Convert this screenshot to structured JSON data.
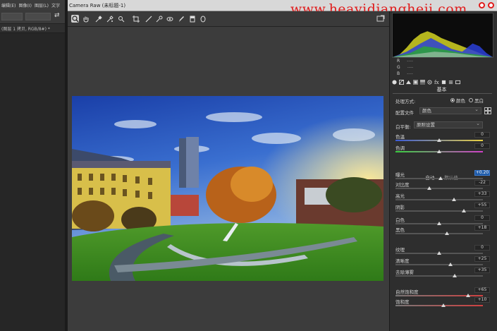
{
  "ps": {
    "menu": [
      "编辑(E)",
      "图像(I)",
      "图层(L)",
      "文字"
    ],
    "doc_tab": "(图层 1 拷贝, RGB/8#) *"
  },
  "camera_raw": {
    "title": "Camera Raw (未标题-1)",
    "watermark": "www.heavidiangheji.com",
    "toolbar_icons": [
      "zoom-icon",
      "hand-icon",
      "white-balance-icon",
      "color-sampler-icon",
      "targeted-adjust-icon",
      "crop-icon",
      "straighten-icon",
      "spot-removal-icon",
      "red-eye-icon",
      "adjustment-brush-icon",
      "graduated-filter-icon",
      "radial-filter-icon"
    ],
    "readout": [
      {
        "label": "R",
        "value": "----"
      },
      {
        "label": "G",
        "value": "----"
      },
      {
        "label": "B",
        "value": "----"
      }
    ],
    "panel": {
      "section_title": "基本",
      "treatment_label": "处理方式:",
      "treatment_options": [
        "颜色",
        "黑白"
      ],
      "treatment_selected": "颜色",
      "profile_label": "配置文件",
      "profile_value": "颜色",
      "wb_label": "白平衡:",
      "wb_value": "原照设置",
      "auto_label": "自动",
      "default_label": "默认值",
      "sliders": [
        {
          "label": "色温",
          "value": "0",
          "level": 0.5,
          "highlight": false
        },
        {
          "label": "色调",
          "value": "0",
          "level": 0.5,
          "highlight": false
        },
        {
          "label": "曝光",
          "value": "+0.20",
          "level": 0.52,
          "highlight": true
        },
        {
          "label": "对比度",
          "value": "-22",
          "level": 0.39,
          "highlight": false
        },
        {
          "label": "高光",
          "value": "+33",
          "level": 0.67,
          "highlight": false
        },
        {
          "label": "阴影",
          "value": "+55",
          "level": 0.78,
          "highlight": false
        },
        {
          "label": "白色",
          "value": "0",
          "level": 0.5,
          "highlight": false
        },
        {
          "label": "黑色",
          "value": "+18",
          "level": 0.59,
          "highlight": false
        },
        {
          "label": "纹理",
          "value": "0",
          "level": 0.5,
          "highlight": false
        },
        {
          "label": "清晰度",
          "value": "+25",
          "level": 0.63,
          "highlight": false
        },
        {
          "label": "去除薄雾",
          "value": "+35",
          "level": 0.68,
          "highlight": false
        },
        {
          "label": "自然饱和度",
          "value": "+65",
          "level": 0.83,
          "highlight": false
        },
        {
          "label": "饱和度",
          "value": "+10",
          "level": 0.55,
          "highlight": false
        }
      ]
    }
  },
  "colors": {
    "accent": "#1e5aa8",
    "watermark": "#e01a1a",
    "panel_bg": "#2e2e2e"
  }
}
